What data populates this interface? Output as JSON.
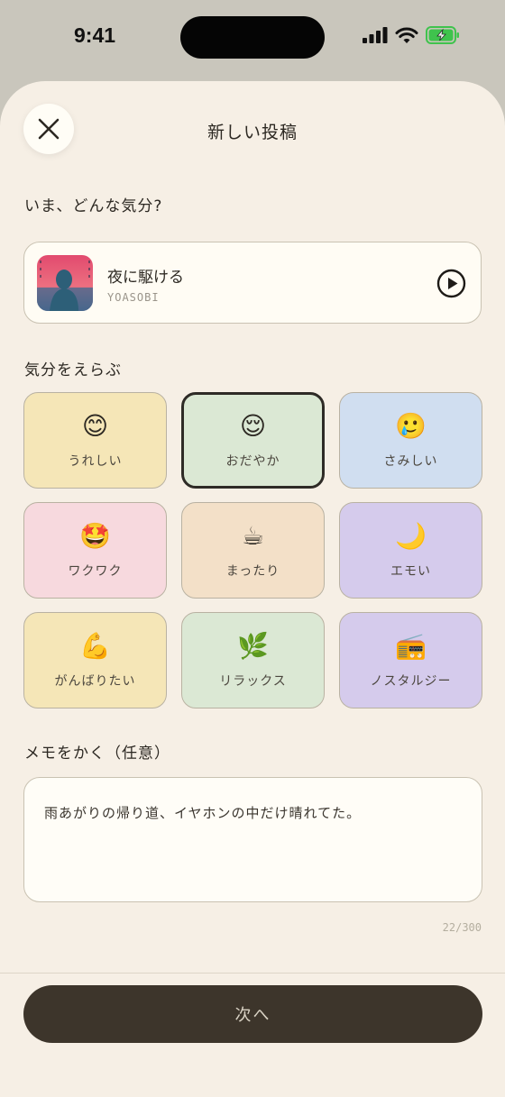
{
  "status": {
    "time": "9:41"
  },
  "sheet": {
    "title": "新しい投稿"
  },
  "prompt": "いま、どんな気分?",
  "song": {
    "title": "夜に駆ける",
    "artist": "YOASOBI"
  },
  "mood_section": {
    "label": "気分をえらぶ",
    "selected": "おだやか",
    "items": [
      {
        "emoji": "😊",
        "label": "うれしい",
        "color": "#f5e6b7"
      },
      {
        "emoji": "😌",
        "label": "おだやか",
        "color": "#dbe8d4"
      },
      {
        "emoji": "🥲",
        "label": "さみしい",
        "color": "#d0def0"
      },
      {
        "emoji": "🤩",
        "label": "ワクワク",
        "color": "#f7d9de"
      },
      {
        "emoji": "☕",
        "label": "まったり",
        "color": "#f3e0c8"
      },
      {
        "emoji": "🌙",
        "label": "エモい",
        "color": "#d5cbec"
      },
      {
        "emoji": "💪",
        "label": "がんばりたい",
        "color": "#f5e6b7"
      },
      {
        "emoji": "🌿",
        "label": "リラックス",
        "color": "#dbe8d4"
      },
      {
        "emoji": "📻",
        "label": "ノスタルジー",
        "color": "#d5cbec"
      }
    ]
  },
  "memo": {
    "label": "メモをかく（任意）",
    "value": "雨あがりの帰り道、イヤホンの中だけ晴れてた。",
    "counter": "22/300"
  },
  "next_button": {
    "label": "次へ"
  },
  "colors": {
    "sheet_bg": "#f6efe5",
    "button_dark": "#3d352b",
    "battery_green": "#3fc34d"
  }
}
